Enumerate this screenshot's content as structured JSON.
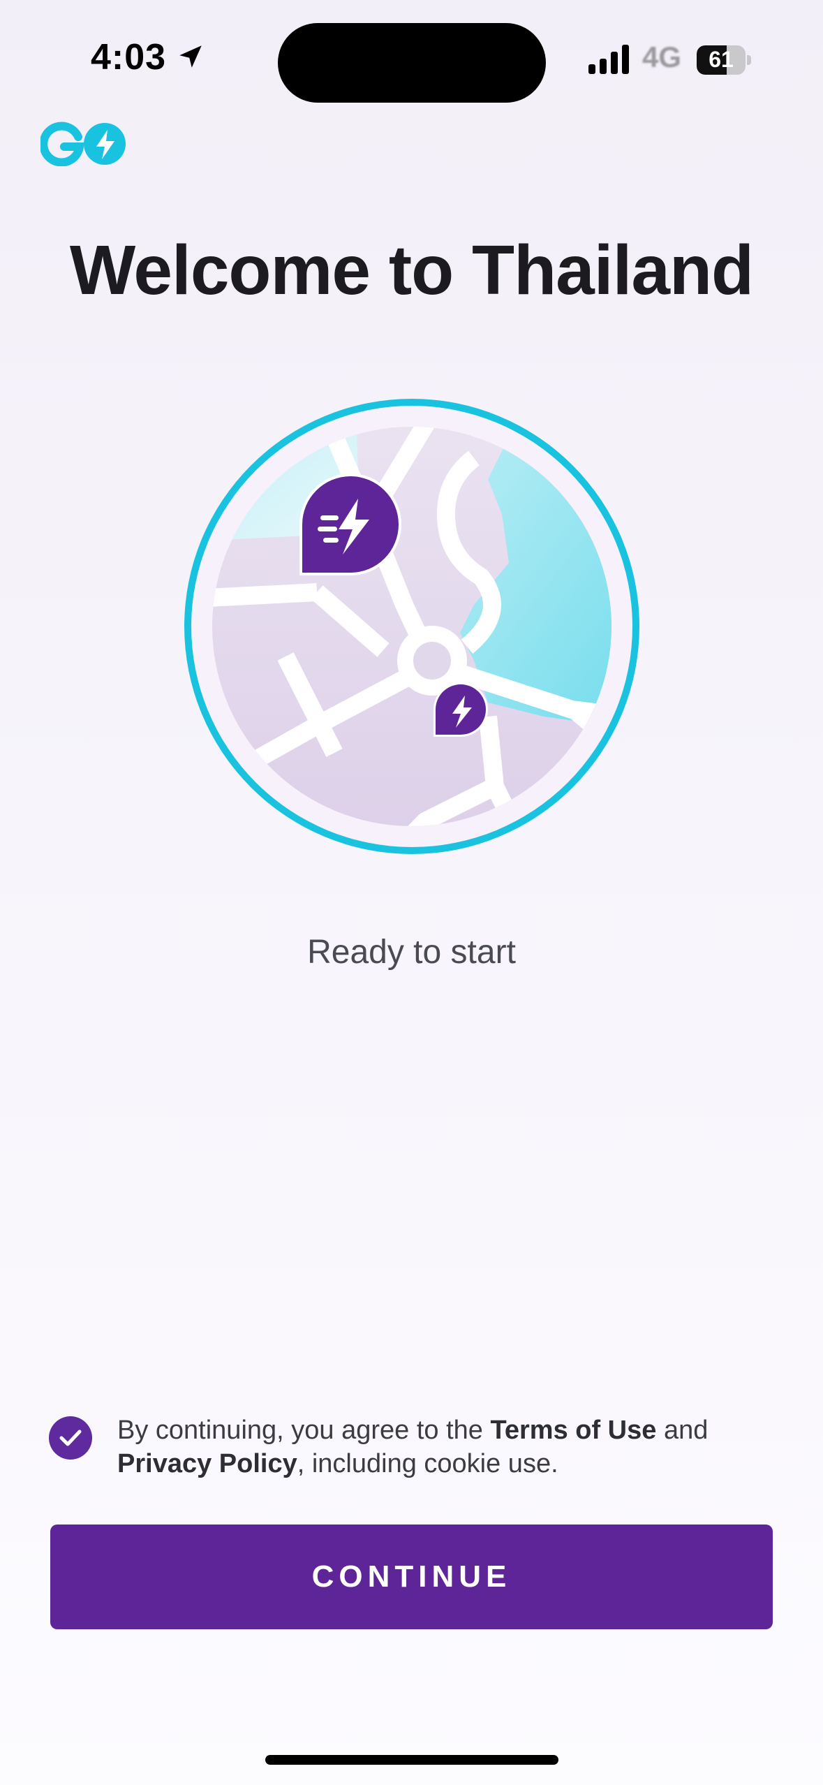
{
  "status_bar": {
    "time": "4:03",
    "network": "4G",
    "battery_level": "61",
    "battery_fraction": 0.61,
    "location_icon": "location-arrow-icon",
    "signal_icon": "cellular-signal-icon"
  },
  "app": {
    "logo_icon": "go-bolt-logo"
  },
  "page": {
    "title": "Welcome to Thailand",
    "status_text": "Ready to start",
    "illustration_icon": "map-with-bolt-pins"
  },
  "consent": {
    "checked": true,
    "prefix": "By continuing, you agree to the ",
    "terms_link": "Terms of Use",
    "middle": " and ",
    "privacy_link": "Privacy Policy",
    "suffix": ", including cookie use."
  },
  "actions": {
    "continue_label": "CONTINUE"
  },
  "colors": {
    "brand_purple": "#5e2599",
    "brand_cyan": "#19c3df",
    "map_lilac": "#e4daee",
    "water": "#9fe6f0"
  }
}
